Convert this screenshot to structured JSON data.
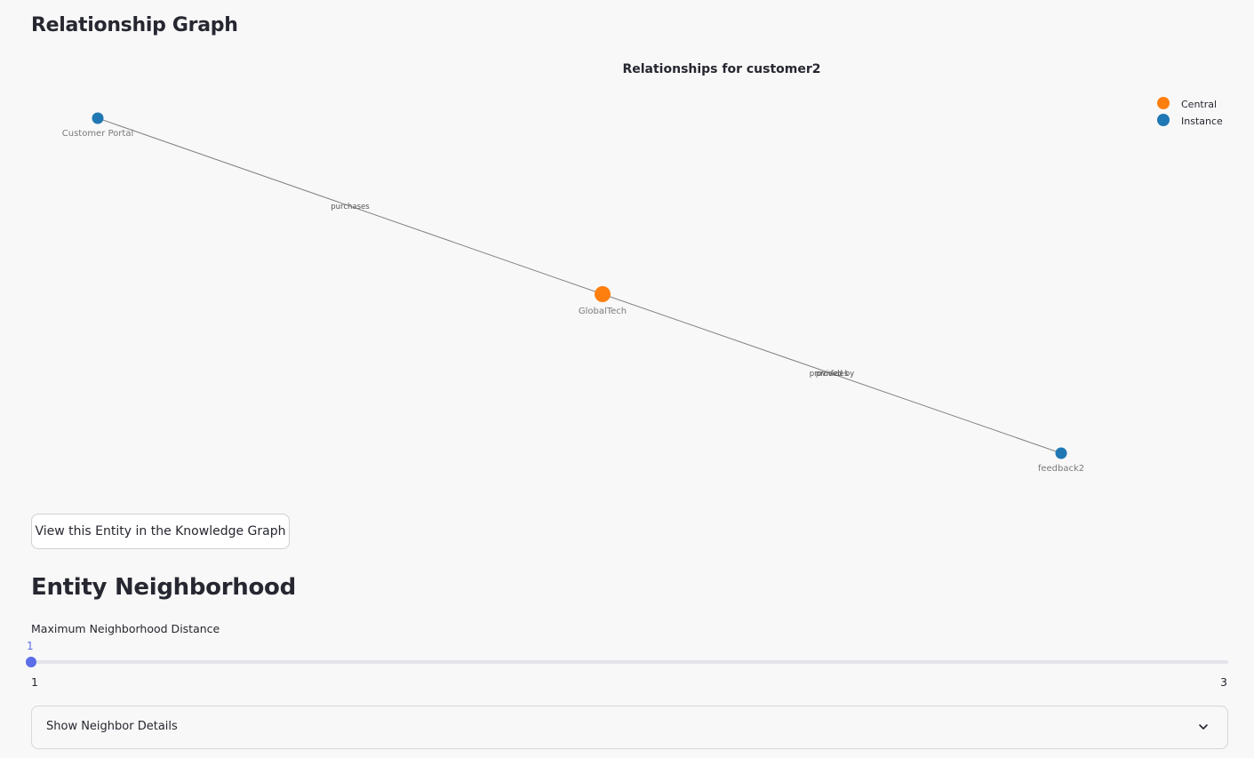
{
  "page": {
    "relationship_title": "Relationship Graph",
    "neighborhood_title": "Entity Neighborhood"
  },
  "graph": {
    "title": "Relationships for customer2",
    "legend": [
      {
        "label": "Central",
        "color": "#ff7f0e"
      },
      {
        "label": "Instance",
        "color": "#1f77b4"
      }
    ],
    "nodes": [
      {
        "id": "portal",
        "label": "Customer Portal",
        "type": "Instance"
      },
      {
        "id": "globaltech",
        "label": "GlobalTech",
        "type": "Central"
      },
      {
        "id": "feedback2",
        "label": "feedback2",
        "type": "Instance"
      }
    ],
    "edges": [
      {
        "from": "portal",
        "to": "globaltech",
        "label": "purchases"
      },
      {
        "from": "globaltech",
        "to": "feedback2",
        "label": "provides"
      },
      {
        "from": "globaltech",
        "to": "feedback2",
        "label": "provided by"
      }
    ],
    "edge_color": "#808080"
  },
  "actions": {
    "view_kg_label": "View this Entity in the Knowledge Graph"
  },
  "neighborhood": {
    "slider_label": "Maximum Neighborhood Distance",
    "value": "1",
    "min": "1",
    "max": "3",
    "accent_color": "#5b6de8",
    "expander_label": "Show Neighbor Details",
    "expander_icon": "chevron-down-icon"
  }
}
